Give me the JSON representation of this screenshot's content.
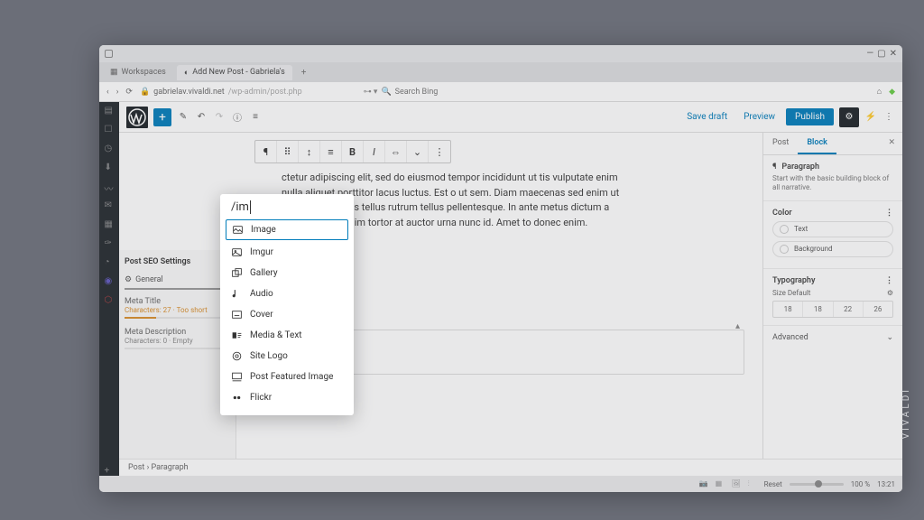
{
  "browser": {
    "tab_workspaces": "Workspaces",
    "tab_active": "Add New Post - Gabriela's",
    "url_host": "gabrielav.vivaldi.net",
    "url_path": "/wp-admin/post.php",
    "search_placeholder": "Search Bing"
  },
  "editbar": {
    "save_draft": "Save draft",
    "preview": "Preview",
    "publish": "Publish"
  },
  "block_toolbar": [
    "¶",
    "⠿",
    "↕",
    "≡",
    "B",
    "I",
    "⇔",
    "⌄",
    "⋮"
  ],
  "paragraph": "ctetur adipiscing elit, sed do eiusmod tempor incididunt ut tis vulputate enim nulla aliquet porttitor lacus luctus. Est o ut sem. Diam maecenas sed enim ut sem viverra. Et as tellus rutrum tellus pellentesque. In ante metus dictum a lacus. Aliquet enim tortor at auctor urna nunc id. Amet to donec enim.",
  "seo": {
    "panel": "Post SEO Settings",
    "general": "General",
    "meta_title": "Meta Title",
    "meta_title_count": "Characters: 27 · Too short",
    "meta_desc": "Meta Description",
    "meta_desc_count": "Characters: 0 · Empty"
  },
  "crumbs": "Post  ›  Paragraph",
  "sidebar": {
    "tab_post": "Post",
    "tab_block": "Block",
    "para_title": "Paragraph",
    "para_desc": "Start with the basic building block of all narrative.",
    "color": "Color",
    "text": "Text",
    "background": "Background",
    "typography": "Typography",
    "size_label": "Size Default",
    "sizes": [
      "18",
      "18",
      "22",
      "26"
    ],
    "advanced": "Advanced"
  },
  "popup": {
    "query": "/im",
    "options": [
      "Image",
      "Imgur",
      "Gallery",
      "Audio",
      "Cover",
      "Media & Text",
      "Site Logo",
      "Post Featured Image",
      "Flickr"
    ]
  },
  "status": {
    "zoom": "100 %",
    "time": "13:21",
    "reset": "Reset"
  },
  "brand": "VIVALDI"
}
